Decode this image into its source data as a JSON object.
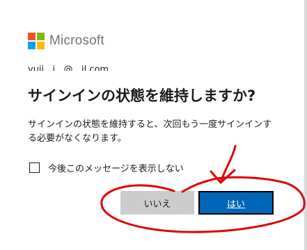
{
  "brand": {
    "name": "Microsoft",
    "colors": [
      "#f25022",
      "#7fba00",
      "#00a4ef",
      "#ffb900"
    ]
  },
  "account": {
    "email": "yuji...i...@...il.com"
  },
  "dialog": {
    "title": "サインインの状態を維持しますか?",
    "description": "サインインの状態を維持すると、次回もう一度サインインする必要がなくなります。",
    "checkbox_label": "今後このメッセージを表示しない",
    "checkbox_checked": false,
    "no_label": "いいえ",
    "yes_label": "はい"
  },
  "colors": {
    "primary_button": "#0067b8",
    "secondary_button": "#cccccc",
    "annotation": "#e00000"
  }
}
